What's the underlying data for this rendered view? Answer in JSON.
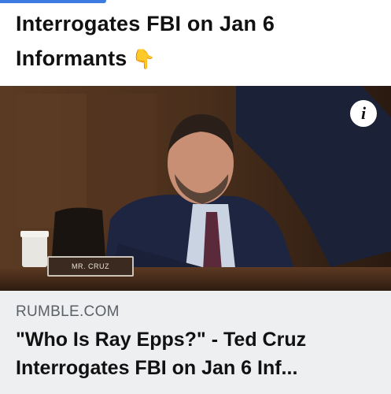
{
  "post": {
    "text_line1": "Interrogates FBI on Jan 6",
    "text_line2": "Informants",
    "emoji": "👇"
  },
  "media": {
    "info_icon": "i",
    "nameplate": "MR. CRUZ"
  },
  "link_card": {
    "domain": "RUMBLE.COM",
    "title_line1": "\"Who Is Ray Epps?\" - Ted Cruz",
    "title_line2": "Interrogates FBI on Jan 6 Inf..."
  },
  "colors": {
    "accent": "#3d7be0",
    "card_background": "#eeeff1"
  }
}
